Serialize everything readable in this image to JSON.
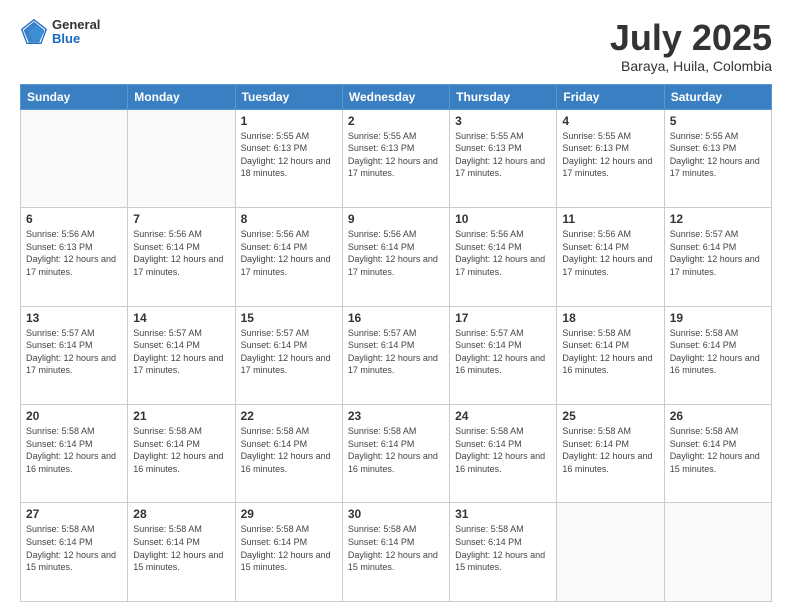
{
  "header": {
    "logo_general": "General",
    "logo_blue": "Blue",
    "title": "July 2025",
    "subtitle": "Baraya, Huila, Colombia"
  },
  "calendar": {
    "days_of_week": [
      "Sunday",
      "Monday",
      "Tuesday",
      "Wednesday",
      "Thursday",
      "Friday",
      "Saturday"
    ],
    "weeks": [
      [
        {
          "day": "",
          "sunrise": "",
          "sunset": "",
          "daylight": ""
        },
        {
          "day": "",
          "sunrise": "",
          "sunset": "",
          "daylight": ""
        },
        {
          "day": "1",
          "sunrise": "Sunrise: 5:55 AM",
          "sunset": "Sunset: 6:13 PM",
          "daylight": "Daylight: 12 hours and 18 minutes."
        },
        {
          "day": "2",
          "sunrise": "Sunrise: 5:55 AM",
          "sunset": "Sunset: 6:13 PM",
          "daylight": "Daylight: 12 hours and 17 minutes."
        },
        {
          "day": "3",
          "sunrise": "Sunrise: 5:55 AM",
          "sunset": "Sunset: 6:13 PM",
          "daylight": "Daylight: 12 hours and 17 minutes."
        },
        {
          "day": "4",
          "sunrise": "Sunrise: 5:55 AM",
          "sunset": "Sunset: 6:13 PM",
          "daylight": "Daylight: 12 hours and 17 minutes."
        },
        {
          "day": "5",
          "sunrise": "Sunrise: 5:55 AM",
          "sunset": "Sunset: 6:13 PM",
          "daylight": "Daylight: 12 hours and 17 minutes."
        }
      ],
      [
        {
          "day": "6",
          "sunrise": "Sunrise: 5:56 AM",
          "sunset": "Sunset: 6:13 PM",
          "daylight": "Daylight: 12 hours and 17 minutes."
        },
        {
          "day": "7",
          "sunrise": "Sunrise: 5:56 AM",
          "sunset": "Sunset: 6:14 PM",
          "daylight": "Daylight: 12 hours and 17 minutes."
        },
        {
          "day": "8",
          "sunrise": "Sunrise: 5:56 AM",
          "sunset": "Sunset: 6:14 PM",
          "daylight": "Daylight: 12 hours and 17 minutes."
        },
        {
          "day": "9",
          "sunrise": "Sunrise: 5:56 AM",
          "sunset": "Sunset: 6:14 PM",
          "daylight": "Daylight: 12 hours and 17 minutes."
        },
        {
          "day": "10",
          "sunrise": "Sunrise: 5:56 AM",
          "sunset": "Sunset: 6:14 PM",
          "daylight": "Daylight: 12 hours and 17 minutes."
        },
        {
          "day": "11",
          "sunrise": "Sunrise: 5:56 AM",
          "sunset": "Sunset: 6:14 PM",
          "daylight": "Daylight: 12 hours and 17 minutes."
        },
        {
          "day": "12",
          "sunrise": "Sunrise: 5:57 AM",
          "sunset": "Sunset: 6:14 PM",
          "daylight": "Daylight: 12 hours and 17 minutes."
        }
      ],
      [
        {
          "day": "13",
          "sunrise": "Sunrise: 5:57 AM",
          "sunset": "Sunset: 6:14 PM",
          "daylight": "Daylight: 12 hours and 17 minutes."
        },
        {
          "day": "14",
          "sunrise": "Sunrise: 5:57 AM",
          "sunset": "Sunset: 6:14 PM",
          "daylight": "Daylight: 12 hours and 17 minutes."
        },
        {
          "day": "15",
          "sunrise": "Sunrise: 5:57 AM",
          "sunset": "Sunset: 6:14 PM",
          "daylight": "Daylight: 12 hours and 17 minutes."
        },
        {
          "day": "16",
          "sunrise": "Sunrise: 5:57 AM",
          "sunset": "Sunset: 6:14 PM",
          "daylight": "Daylight: 12 hours and 17 minutes."
        },
        {
          "day": "17",
          "sunrise": "Sunrise: 5:57 AM",
          "sunset": "Sunset: 6:14 PM",
          "daylight": "Daylight: 12 hours and 16 minutes."
        },
        {
          "day": "18",
          "sunrise": "Sunrise: 5:58 AM",
          "sunset": "Sunset: 6:14 PM",
          "daylight": "Daylight: 12 hours and 16 minutes."
        },
        {
          "day": "19",
          "sunrise": "Sunrise: 5:58 AM",
          "sunset": "Sunset: 6:14 PM",
          "daylight": "Daylight: 12 hours and 16 minutes."
        }
      ],
      [
        {
          "day": "20",
          "sunrise": "Sunrise: 5:58 AM",
          "sunset": "Sunset: 6:14 PM",
          "daylight": "Daylight: 12 hours and 16 minutes."
        },
        {
          "day": "21",
          "sunrise": "Sunrise: 5:58 AM",
          "sunset": "Sunset: 6:14 PM",
          "daylight": "Daylight: 12 hours and 16 minutes."
        },
        {
          "day": "22",
          "sunrise": "Sunrise: 5:58 AM",
          "sunset": "Sunset: 6:14 PM",
          "daylight": "Daylight: 12 hours and 16 minutes."
        },
        {
          "day": "23",
          "sunrise": "Sunrise: 5:58 AM",
          "sunset": "Sunset: 6:14 PM",
          "daylight": "Daylight: 12 hours and 16 minutes."
        },
        {
          "day": "24",
          "sunrise": "Sunrise: 5:58 AM",
          "sunset": "Sunset: 6:14 PM",
          "daylight": "Daylight: 12 hours and 16 minutes."
        },
        {
          "day": "25",
          "sunrise": "Sunrise: 5:58 AM",
          "sunset": "Sunset: 6:14 PM",
          "daylight": "Daylight: 12 hours and 16 minutes."
        },
        {
          "day": "26",
          "sunrise": "Sunrise: 5:58 AM",
          "sunset": "Sunset: 6:14 PM",
          "daylight": "Daylight: 12 hours and 15 minutes."
        }
      ],
      [
        {
          "day": "27",
          "sunrise": "Sunrise: 5:58 AM",
          "sunset": "Sunset: 6:14 PM",
          "daylight": "Daylight: 12 hours and 15 minutes."
        },
        {
          "day": "28",
          "sunrise": "Sunrise: 5:58 AM",
          "sunset": "Sunset: 6:14 PM",
          "daylight": "Daylight: 12 hours and 15 minutes."
        },
        {
          "day": "29",
          "sunrise": "Sunrise: 5:58 AM",
          "sunset": "Sunset: 6:14 PM",
          "daylight": "Daylight: 12 hours and 15 minutes."
        },
        {
          "day": "30",
          "sunrise": "Sunrise: 5:58 AM",
          "sunset": "Sunset: 6:14 PM",
          "daylight": "Daylight: 12 hours and 15 minutes."
        },
        {
          "day": "31",
          "sunrise": "Sunrise: 5:58 AM",
          "sunset": "Sunset: 6:14 PM",
          "daylight": "Daylight: 12 hours and 15 minutes."
        },
        {
          "day": "",
          "sunrise": "",
          "sunset": "",
          "daylight": ""
        },
        {
          "day": "",
          "sunrise": "",
          "sunset": "",
          "daylight": ""
        }
      ]
    ]
  }
}
